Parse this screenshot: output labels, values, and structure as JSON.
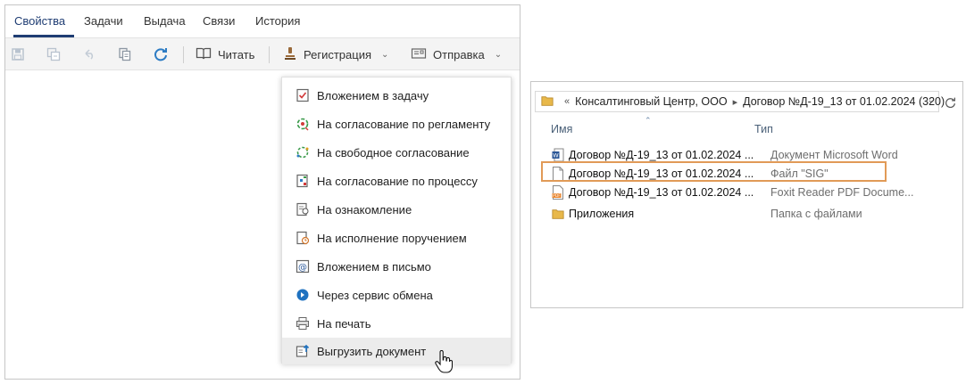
{
  "tabs": [
    {
      "label": "Свойства",
      "active": true
    },
    {
      "label": "Задачи",
      "active": false
    },
    {
      "label": "Выдача",
      "active": false
    },
    {
      "label": "Связи",
      "active": false
    },
    {
      "label": "История",
      "active": false
    }
  ],
  "toolbar": {
    "icons": [
      "save-icon",
      "save-copy-icon",
      "undo-icon",
      "copy-icon",
      "refresh-icon"
    ],
    "read_label": "Читать",
    "register_label": "Регистрация",
    "send_label": "Отправка"
  },
  "send_menu": {
    "items": [
      {
        "label": "Вложением в задачу",
        "icon": "task-attach-icon"
      },
      {
        "label": "На согласование по регламенту",
        "icon": "regulation-approval-icon"
      },
      {
        "label": "На свободное согласование",
        "icon": "free-approval-icon"
      },
      {
        "label": "На согласование по процессу",
        "icon": "process-approval-icon"
      },
      {
        "label": "На ознакомление",
        "icon": "acquaintance-icon"
      },
      {
        "label": "На исполнение поручением",
        "icon": "execution-icon"
      },
      {
        "label": "Вложением в письмо",
        "icon": "mail-attach-icon"
      },
      {
        "label": "Через сервис обмена",
        "icon": "exchange-service-icon"
      },
      {
        "label": "На печать",
        "icon": "print-icon"
      },
      {
        "label": "Выгрузить документ",
        "icon": "export-document-icon",
        "hovered": true
      }
    ]
  },
  "explorer": {
    "breadcrumb": [
      "Консалтинговый Центр, ООО",
      "Договор №Д-19_13 от 01.02.2024 (320)"
    ],
    "breadcrumb_prefix": "«",
    "columns": {
      "name": "Имя",
      "type": "Тип"
    },
    "files": [
      {
        "name": "Договор №Д-19_13 от 01.02.2024 ...",
        "type": "Документ Microsoft Word",
        "icon": "word-file-icon"
      },
      {
        "name": "Договор №Д-19_13 от 01.02.2024 ...",
        "type": "Файл \"SIG\"",
        "icon": "blank-file-icon",
        "highlighted": true
      },
      {
        "name": "Договор №Д-19_13 от 01.02.2024 ...",
        "type": "Foxit Reader PDF Docume...",
        "icon": "pdf-file-icon"
      },
      {
        "name": "Приложения",
        "type": "Папка с файлами",
        "icon": "folder-icon"
      }
    ],
    "highlight_color": "#e19a57"
  },
  "colors": {
    "accent": "#1f3d73",
    "toolbar_bg": "#f4f4f4"
  }
}
